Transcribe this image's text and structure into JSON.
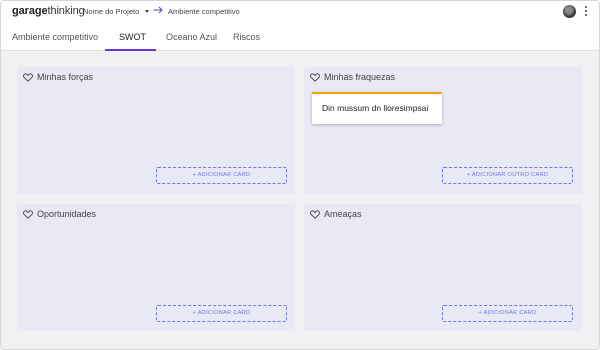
{
  "header": {
    "logo_bold": "garage",
    "logo_light": "thinking",
    "project_label": "Nome do Projeto",
    "breadcrumb": "Ambiente competitivo"
  },
  "tabs": [
    {
      "label": "Ambiente competitivo",
      "active": false
    },
    {
      "label": "SWOT",
      "active": true
    },
    {
      "label": "Oceano Azul",
      "active": false
    },
    {
      "label": "Riscos",
      "active": false
    }
  ],
  "panels": [
    {
      "title": "Minhas forças",
      "button": "+ ADICIONAR CARD",
      "cards": []
    },
    {
      "title": "Minhas fraquezas",
      "button": "+ ADICIONAR OUTRO CARD",
      "cards": [
        "Din mussum dn lloresimpsai"
      ]
    },
    {
      "title": "Oportunidades",
      "button": "+ ADICIONAR CARD",
      "cards": []
    },
    {
      "title": "Ameaças",
      "button": "+ ADICIONAR CARD",
      "cards": []
    }
  ],
  "colors": {
    "accent": "#6a35d9",
    "panel_bg": "#e8e9f5",
    "button": "#6f76e0",
    "card_top": "#f0a500"
  },
  "icons": [
    "chevron-down-icon",
    "arrow-right-icon",
    "heart-icon",
    "more-vert-icon"
  ]
}
